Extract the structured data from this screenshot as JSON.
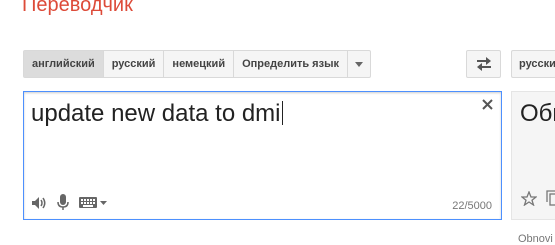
{
  "header": {
    "title": "Переводчик"
  },
  "source_languages": [
    "английский",
    "русский",
    "немецкий",
    "Определить язык"
  ],
  "source_selected_index": 0,
  "target_languages": [
    "русский"
  ],
  "source": {
    "text": "update new data to dmi",
    "counter": "22/5000"
  },
  "result": {
    "text": "Обн",
    "footer": "Obnovi"
  },
  "icons": {
    "clear": "close-icon",
    "swap": "swap-languages-icon",
    "speaker": "speaker-icon",
    "mic": "microphone-icon",
    "keyboard": "keyboard-icon",
    "star": "star-icon",
    "copy": "copy-icon"
  },
  "colors": {
    "title": "#dd4b39",
    "focus_border": "#4d90fe"
  }
}
